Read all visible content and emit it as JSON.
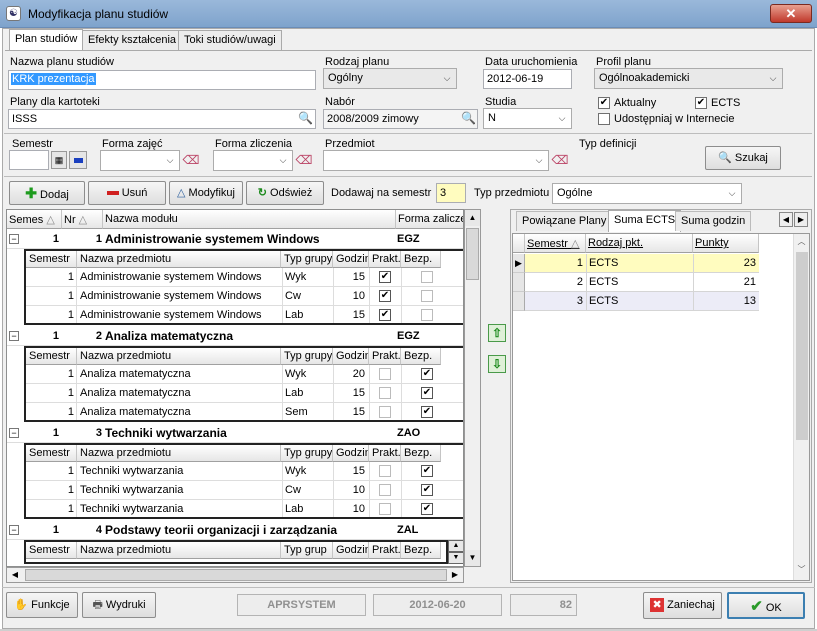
{
  "window": {
    "title": "Modyfikacja planu studiów",
    "close": "✕"
  },
  "tabs": [
    "Plan studiów",
    "Efekty kształcenia",
    "Toki studiów/uwagi"
  ],
  "form": {
    "nazwa_label": "Nazwa planu studiów",
    "nazwa_value": "KRK prezentacja",
    "rodzaj_label": "Rodzaj planu",
    "rodzaj_value": "Ogólny",
    "data_label": "Data uruchomienia",
    "data_value": "2012-06-19",
    "profil_label": "Profil planu",
    "profil_value": "Ogólnoakademicki",
    "kartoteki_label": "Plany dla kartoteki",
    "kartoteki_value": "ISSS",
    "nabor_label": "Nabór",
    "nabor_value": "2008/2009 zimowy",
    "studia_label": "Studia",
    "studia_value": "N",
    "aktualny_label": "Aktualny",
    "ects_label": "ECTS",
    "udostepniaj_label": "Udostępniaj w Internecie"
  },
  "filter": {
    "semestr_label": "Semestr",
    "forma_zajec_label": "Forma zajęć",
    "forma_zaliczenia_label": "Forma zliczenia",
    "przedmiot_label": "Przedmiot",
    "typ_definicji_label": "Typ definicji",
    "szukaj": "Szukaj"
  },
  "toolbar": {
    "dodaj": "Dodaj",
    "usun": "Usuń",
    "modyfikuj": "Modyfikuj",
    "odswiez": "Odśwież",
    "dodawaj_label": "Dodawaj na semestr",
    "dodawaj_value": "3",
    "typ_label": "Typ przedmiotu",
    "typ_value": "Ogólne"
  },
  "grid": {
    "headers": [
      "Semes",
      "Nr",
      "Nazwa modułu",
      "Forma zalicze"
    ],
    "subheaders": [
      "Semestr",
      "Nazwa przedmiotu",
      "Typ grupy",
      "Godzin",
      "Prakt.",
      "Bezp."
    ],
    "modules": [
      {
        "sem": "1",
        "nr": "1",
        "name": "Administrowanie systemem Windows",
        "forma": "EGZ",
        "rows": [
          {
            "sem": "1",
            "name": "Administrowanie systemem Windows",
            "typ": "Wyk",
            "godz": "15",
            "prakt": true,
            "bezp": false
          },
          {
            "sem": "1",
            "name": "Administrowanie systemem Windows",
            "typ": "Cw",
            "godz": "10",
            "prakt": true,
            "bezp": false
          },
          {
            "sem": "1",
            "name": "Administrowanie systemem Windows",
            "typ": "Lab",
            "godz": "15",
            "prakt": true,
            "bezp": false
          }
        ]
      },
      {
        "sem": "1",
        "nr": "2",
        "name": "Analiza matematyczna",
        "forma": "EGZ",
        "rows": [
          {
            "sem": "1",
            "name": "Analiza matematyczna",
            "typ": "Wyk",
            "godz": "20",
            "prakt": false,
            "bezp": true
          },
          {
            "sem": "1",
            "name": "Analiza matematyczna",
            "typ": "Lab",
            "godz": "15",
            "prakt": false,
            "bezp": true
          },
          {
            "sem": "1",
            "name": "Analiza matematyczna",
            "typ": "Sem",
            "godz": "15",
            "prakt": false,
            "bezp": true
          }
        ]
      },
      {
        "sem": "1",
        "nr": "3",
        "name": "Techniki wytwarzania",
        "forma": "ZAO",
        "rows": [
          {
            "sem": "1",
            "name": "Techniki wytwarzania",
            "typ": "Wyk",
            "godz": "15",
            "prakt": false,
            "bezp": true
          },
          {
            "sem": "1",
            "name": "Techniki wytwarzania",
            "typ": "Cw",
            "godz": "10",
            "prakt": false,
            "bezp": true
          },
          {
            "sem": "1",
            "name": "Techniki wytwarzania",
            "typ": "Lab",
            "godz": "10",
            "prakt": false,
            "bezp": true
          }
        ]
      },
      {
        "sem": "1",
        "nr": "4",
        "name": "Podstawy teorii organizacji i zarządzania",
        "forma": "ZAL",
        "rows": []
      }
    ],
    "last_subheaders": [
      "Semestr",
      "Nazwa przedmiotu",
      "Typ grup",
      "Godzin",
      "Prakt.",
      "Bezp."
    ]
  },
  "right": {
    "tabs": [
      "Powiązane Plany",
      "Suma ECTS",
      "Suma godzin"
    ],
    "headers": [
      "Semestr",
      "Rodzaj pkt.",
      "Punkty"
    ],
    "rows": [
      {
        "sem": "1",
        "rodzaj": "ECTS",
        "pkt": "23"
      },
      {
        "sem": "2",
        "rodzaj": "ECTS",
        "pkt": "21"
      },
      {
        "sem": "3",
        "rodzaj": "ECTS",
        "pkt": "13"
      }
    ]
  },
  "bottom": {
    "funkcje": "Funkcje",
    "wydruki": "Wydruki",
    "status1": "APRSYSTEM",
    "status2": "2012-06-20",
    "status3": "82",
    "zaniechaj": "Zaniechaj",
    "ok": "OK"
  },
  "colors": {
    "title_bg": "#8fb0d6",
    "highlight": "#fffcbf",
    "selection": "#3399ff",
    "alt_row": "#ececf7"
  }
}
